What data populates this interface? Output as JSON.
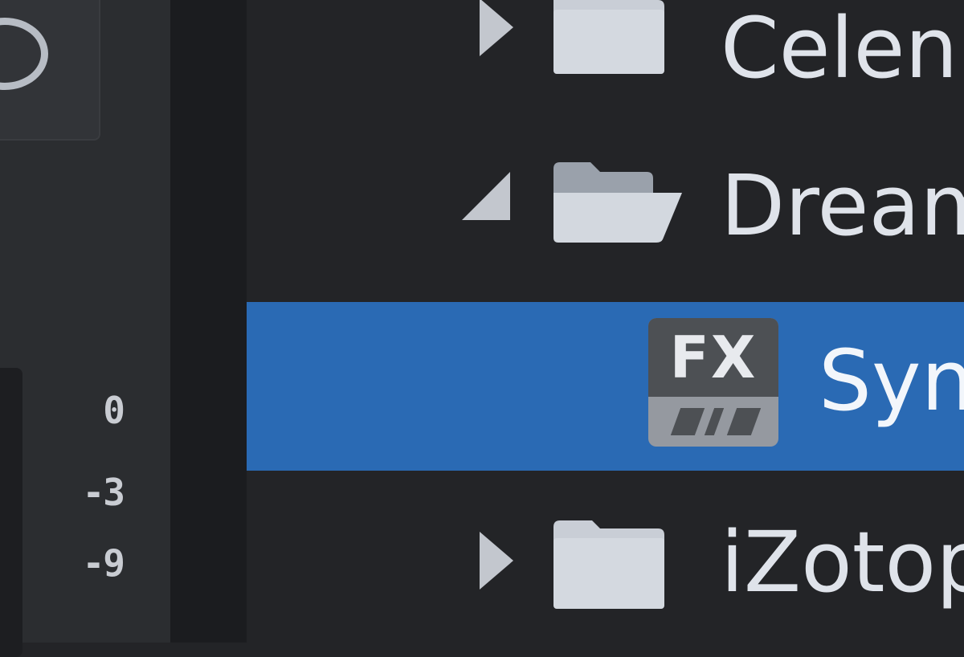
{
  "meter": {
    "scale_labels": [
      "0",
      "-3",
      "-9"
    ]
  },
  "browser": {
    "rows": [
      {
        "label": "Celen",
        "kind": "folder",
        "state": "collapsed",
        "icon": "folder-closed-icon"
      },
      {
        "label": "Dream",
        "kind": "folder",
        "state": "expanded",
        "icon": "folder-open-icon"
      },
      {
        "label": "Syn",
        "kind": "plugin",
        "selected": true,
        "icon": "fx-plugin-icon",
        "badge_text": "FX"
      },
      {
        "label": "iZotop",
        "kind": "folder",
        "state": "collapsed",
        "icon": "folder-closed-icon"
      }
    ]
  },
  "colors": {
    "background": "#232427",
    "selection": "#2a6ab4",
    "icon_gray": "#c3c7ce"
  }
}
